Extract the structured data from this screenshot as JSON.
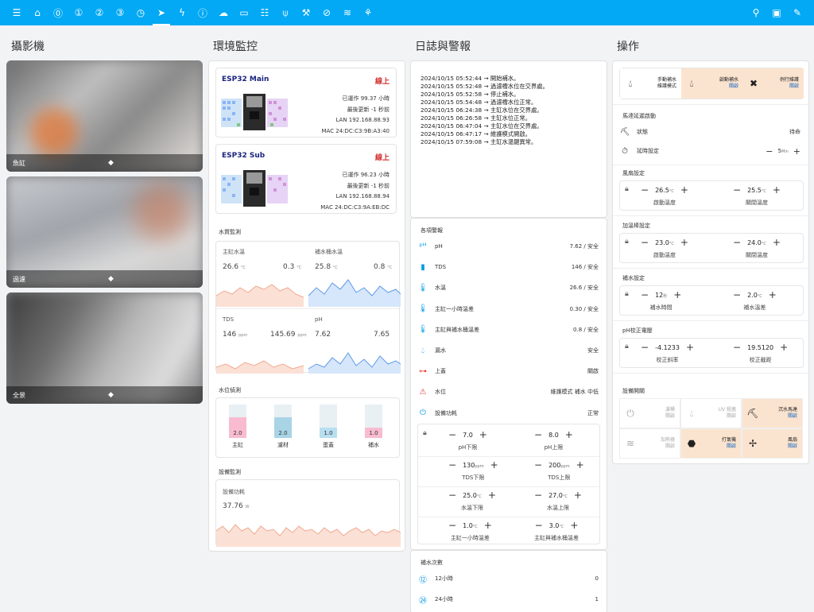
{
  "topbar": {
    "icons": [
      "menu-icon",
      "home-icon",
      "zero-circle-icon",
      "one-circle-icon",
      "two-circle-icon",
      "three-circle-icon",
      "clock-icon",
      "fish-icon",
      "bolt-icon",
      "info-icon",
      "cloud-icon",
      "car-icon",
      "server-icon",
      "wifi-tower-icon",
      "robot-arm-icon",
      "compass-icon",
      "wifi-icon",
      "plant-icon"
    ],
    "right_icons": [
      "search-icon",
      "chat-icon",
      "pencil-icon"
    ]
  },
  "columns": {
    "camera": "攝影機",
    "env": "環境監控",
    "log": "日誌與警報",
    "ops": "操作"
  },
  "cameras": [
    {
      "label": "魚缸"
    },
    {
      "label": "過濾"
    },
    {
      "label": "全景"
    }
  ],
  "esp": [
    {
      "name": "ESP32 Main",
      "status": "線上",
      "uptime": "已運作 99.37 小時",
      "updated": "最後更新 -1 秒前",
      "lan": "LAN 192.168.88.93",
      "mac": "MAC 24:DC:C3:9B:A3:40"
    },
    {
      "name": "ESP32 Sub",
      "status": "線上",
      "uptime": "已運作 96.23 小時",
      "updated": "最後更新 -1 秒前",
      "lan": "LAN 192.168.88.94",
      "mac": "MAC 24:DC:C3:9A:EB:DC"
    }
  ],
  "water_quality": {
    "title": "水質監測",
    "temp_main_label": "主缸水溫",
    "temp_main_value": "26.6",
    "temp_unit": "°C",
    "temp_change": "0.3",
    "temp_refill_label": "補水桶水溫",
    "temp_refill_value": "25.8",
    "temp_refill_change": "0.8",
    "tds_label": "TDS",
    "tds_value": "146",
    "tds_unit": "ppm",
    "tds_avg": "145.69",
    "ph_label": "pH",
    "ph_value": "7.62",
    "ph_avg": "7.65"
  },
  "water_level": {
    "title": "水位偵測",
    "bars": [
      {
        "label": "主缸",
        "value": "2.0",
        "fill": 0.62,
        "color": "#f8bbd0"
      },
      {
        "label": "濾材",
        "value": "2.0",
        "fill": 0.62,
        "color": "#a8d4e6"
      },
      {
        "label": "蛋蓋",
        "value": "1.0",
        "fill": 0.32,
        "color": "#b8dff0"
      },
      {
        "label": "補水",
        "value": "1.0",
        "fill": 0.32,
        "color": "#f8bbd0"
      }
    ]
  },
  "device": {
    "title": "設備監測",
    "power_label": "設備功耗",
    "power_value": "37.76",
    "power_unit": "W"
  },
  "log_lines": [
    "2024/10/15 05:52:44 → 開始補水。",
    "2024/10/15 05:52:48 → 過濾槽水位在交界處。",
    "2024/10/15 05:52:58 → 停止補水。",
    "2024/10/15 05:54:48 → 過濾槽水位正常。",
    "2024/10/15 06:24:38 → 主缸水位在交界處。",
    "2024/10/15 06:26:58 → 主缸水位正常。",
    "2024/10/15 06:47:04 → 主缸水位在交界處。",
    "2024/10/15 06:47:17 → 維護模式開啟。",
    "2024/10/15 07:59:08 → 主缸水溫鍵異常。"
  ],
  "alerts": {
    "title": "各項警報",
    "rows": [
      {
        "icon": "ph-icon",
        "label": "pH",
        "value": "7.62 / 安全"
      },
      {
        "icon": "tds-icon",
        "label": "TDS",
        "value": "146 / 安全"
      },
      {
        "icon": "thermometer-icon",
        "label": "水溫",
        "value": "26.6 / 安全"
      },
      {
        "icon": "thermometer-icon",
        "label": "主缸一小時溫差",
        "value": "0.30 / 安全"
      },
      {
        "icon": "thermometer-icon",
        "label": "主缸與補水桶溫差",
        "value": "0.8 / 安全"
      },
      {
        "icon": "drop-icon",
        "label": "漏水",
        "value": "安全"
      },
      {
        "icon": "lid-icon",
        "label": "上蓋",
        "value": "關啟"
      },
      {
        "icon": "alert-icon",
        "label": "水位",
        "value": "維護模式 補水 中低"
      },
      {
        "icon": "power-icon",
        "label": "設備功耗",
        "value": "正常"
      }
    ],
    "limits": [
      {
        "left_val": "7.0",
        "left_unit": "",
        "left_cap": "pH下限",
        "right_val": "8.0",
        "right_unit": "",
        "right_cap": "pH上限"
      },
      {
        "left_val": "130",
        "left_unit": "ppm",
        "left_cap": "TDS下限",
        "right_val": "200",
        "right_unit": "ppm",
        "right_cap": "TDS上限"
      },
      {
        "left_val": "25.0",
        "left_unit": "°C",
        "left_cap": "水溫下限",
        "right_val": "27.0",
        "right_unit": "°C",
        "right_cap": "水溫上限"
      },
      {
        "left_val": "1.0",
        "left_unit": "°C",
        "left_cap": "主缸一小時溫差",
        "right_val": "3.0",
        "right_unit": "°C",
        "right_cap": "主缸與補水桶溫差"
      }
    ]
  },
  "refill_count": {
    "title": "補水次數",
    "rows": [
      {
        "label": "12小時",
        "value": "0"
      },
      {
        "label": "24小時",
        "value": "1"
      }
    ]
  },
  "ops": {
    "modes": [
      {
        "l1": "手動補水",
        "l2": "維護模式",
        "status": ""
      },
      {
        "l1": "啟動補水",
        "l2": "",
        "status": "關啟"
      },
      {
        "l1": "例行維護",
        "l2": "",
        "status": "關啟"
      }
    ],
    "feeder": {
      "title": "馬達延遲啟動",
      "status_label": "狀態",
      "status_value": "待命",
      "delay_label": "延時設定",
      "delay_value": "5",
      "delay_unit": "Min"
    },
    "fan": {
      "title": "風扇設定",
      "on_val": "26.5",
      "on_cap": "啟動溫度",
      "off_val": "25.5",
      "off_cap": "關閉溫度",
      "unit": "°C"
    },
    "heater": {
      "title": "加溫棒設定",
      "on_val": "23.0",
      "on_cap": "啟動溫度",
      "off_val": "24.0",
      "off_cap": "關閉溫度",
      "unit": "°C"
    },
    "refill": {
      "title": "補水設定",
      "a_val": "12",
      "a_unit": "秒",
      "a_cap": "補水時間",
      "b_val": "2.0",
      "b_unit": "°C",
      "b_cap": "補水溫差"
    },
    "ph_cal": {
      "title": "pH校正電壓",
      "a_val": "-4.1233",
      "a_cap": "校正斜率",
      "b_val": "19.5120",
      "b_cap": "校正截距"
    },
    "switches_title": "設備開關",
    "switches": [
      {
        "l1": "濾桶",
        "l2": "關啟",
        "status": "",
        "on": false
      },
      {
        "l1": "UV 殺菌",
        "l2": "關啟",
        "status": "",
        "on": false
      },
      {
        "l1": "沉水馬達",
        "l2": "",
        "status": "關啟",
        "on": true
      },
      {
        "l1": "加熱器",
        "l2": "關啟",
        "status": "",
        "on": false
      },
      {
        "l1": "打氣機",
        "l2": "",
        "status": "關啟",
        "on": true
      },
      {
        "l1": "風扇",
        "l2": "",
        "status": "關啟",
        "on": true
      }
    ]
  }
}
